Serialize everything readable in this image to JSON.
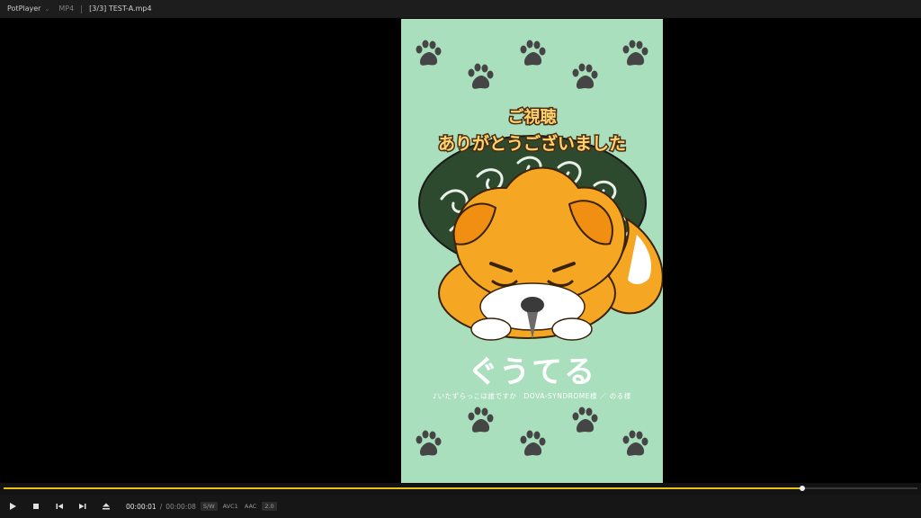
{
  "titlebar": {
    "app_name": "PotPlayer",
    "format": "MP4",
    "file_title": "[3/3] TEST-A.mp4"
  },
  "video": {
    "caption_line1": "ご視聴",
    "caption_line2": "ありがとうございました",
    "ending_title": "ぐうてる",
    "credit": "♪いたずらっこは誰ですか　DOVA-SYNDROME様 ／ のる様",
    "background_color": "#a9dfbc",
    "paw_color": "#454545"
  },
  "player": {
    "seek_progress": 0.874,
    "current_time": "00:00:01",
    "time_separator": "/",
    "total_time": "00:00:08",
    "badges": [
      "S/W",
      "AVC1",
      "AAC",
      "2.0"
    ],
    "buttons": [
      "play-icon",
      "stop-icon",
      "previous-icon",
      "next-icon",
      "eject-icon"
    ],
    "accent_color": "#e8c21a"
  }
}
